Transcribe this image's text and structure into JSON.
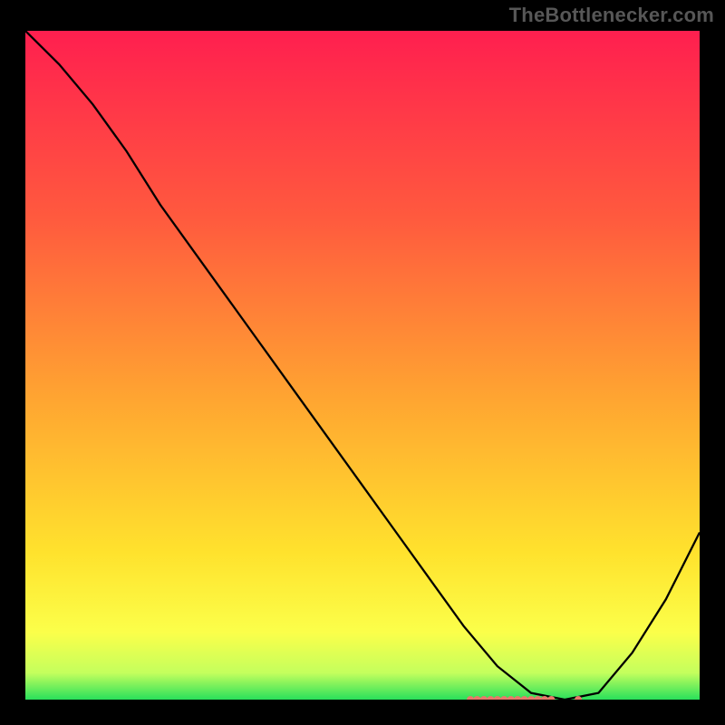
{
  "watermark": "TheBottlenecker.com",
  "chart_data": {
    "type": "line",
    "title": "",
    "xlabel": "",
    "ylabel": "",
    "xlim": [
      0,
      100
    ],
    "ylim": [
      0,
      100
    ],
    "x": [
      0,
      5,
      10,
      15,
      20,
      25,
      30,
      35,
      40,
      45,
      50,
      55,
      60,
      65,
      70,
      75,
      80,
      85,
      90,
      95,
      100
    ],
    "values": [
      100,
      95,
      89,
      82,
      74,
      67,
      60,
      53,
      46,
      39,
      32,
      25,
      18,
      11,
      5,
      1,
      0,
      1,
      7,
      15,
      25
    ],
    "markers": {
      "x": [
        66,
        67,
        68,
        69,
        70,
        71,
        72,
        73,
        74,
        75,
        76,
        77,
        78,
        82
      ],
      "y": [
        0,
        0,
        0,
        0,
        0,
        0,
        0,
        0,
        0,
        0,
        0,
        0,
        0,
        0
      ],
      "color": "#e8786a"
    },
    "gradient_stops": [
      {
        "offset": 0.0,
        "color": "#ff1f4f"
      },
      {
        "offset": 0.28,
        "color": "#ff5a3e"
      },
      {
        "offset": 0.55,
        "color": "#ffa531"
      },
      {
        "offset": 0.78,
        "color": "#ffe22d"
      },
      {
        "offset": 0.9,
        "color": "#fbff4a"
      },
      {
        "offset": 0.96,
        "color": "#c4ff5d"
      },
      {
        "offset": 1.0,
        "color": "#29e05b"
      }
    ]
  }
}
